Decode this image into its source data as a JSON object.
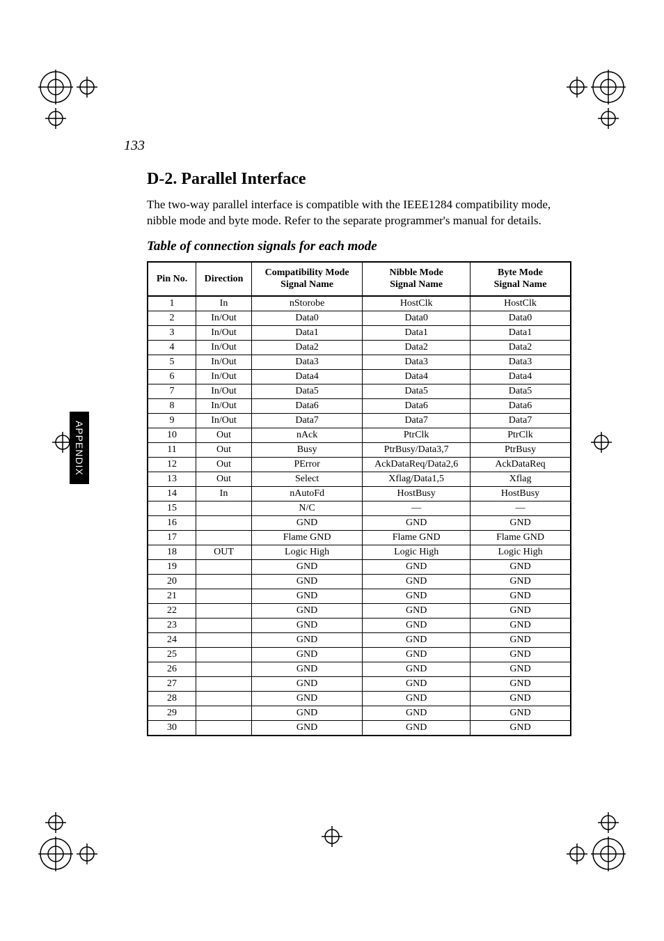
{
  "page_number": "133",
  "heading": "D-2.  Parallel Interface",
  "intro": "The two-way parallel interface is compatible with the IEEE1284 compatibility mode, nibble mode and byte mode. Refer to the separate programmer's manual for details.",
  "table_caption": "Table of connection signals for each mode",
  "side_tab": "APPENDIX",
  "headers": {
    "pin": "Pin No.",
    "dir": "Direction",
    "compat_l1": "Compatibility Mode",
    "compat_l2": "Signal Name",
    "nibble_l1": "Nibble Mode",
    "nibble_l2": "Signal Name",
    "byte_l1": "Byte Mode",
    "byte_l2": "Signal Name"
  },
  "rows": [
    {
      "pin": "1",
      "dir": "In",
      "compat": "nStorobe",
      "nibble": "HostClk",
      "byte": "HostClk"
    },
    {
      "pin": "2",
      "dir": "In/Out",
      "compat": "Data0",
      "nibble": "Data0",
      "byte": "Data0"
    },
    {
      "pin": "3",
      "dir": "In/Out",
      "compat": "Data1",
      "nibble": "Data1",
      "byte": "Data1"
    },
    {
      "pin": "4",
      "dir": "In/Out",
      "compat": "Data2",
      "nibble": "Data2",
      "byte": "Data2"
    },
    {
      "pin": "5",
      "dir": "In/Out",
      "compat": "Data3",
      "nibble": "Data3",
      "byte": "Data3"
    },
    {
      "pin": "6",
      "dir": "In/Out",
      "compat": "Data4",
      "nibble": "Data4",
      "byte": "Data4"
    },
    {
      "pin": "7",
      "dir": "In/Out",
      "compat": "Data5",
      "nibble": "Data5",
      "byte": "Data5"
    },
    {
      "pin": "8",
      "dir": "In/Out",
      "compat": "Data6",
      "nibble": "Data6",
      "byte": "Data6"
    },
    {
      "pin": "9",
      "dir": "In/Out",
      "compat": "Data7",
      "nibble": "Data7",
      "byte": "Data7"
    },
    {
      "pin": "10",
      "dir": "Out",
      "compat": "nAck",
      "nibble": "PtrClk",
      "byte": "PtrClk"
    },
    {
      "pin": "11",
      "dir": "Out",
      "compat": "Busy",
      "nibble": "PtrBusy/Data3,7",
      "byte": "PtrBusy"
    },
    {
      "pin": "12",
      "dir": "Out",
      "compat": "PError",
      "nibble": "AckDataReq/Data2,6",
      "byte": "AckDataReq"
    },
    {
      "pin": "13",
      "dir": "Out",
      "compat": "Select",
      "nibble": "Xflag/Data1,5",
      "byte": "Xflag"
    },
    {
      "pin": "14",
      "dir": "In",
      "compat": "nAutoFd",
      "nibble": "HostBusy",
      "byte": "HostBusy"
    },
    {
      "pin": "15",
      "dir": "",
      "compat": "N/C",
      "nibble": "—",
      "byte": "—"
    },
    {
      "pin": "16",
      "dir": "",
      "compat": "GND",
      "nibble": "GND",
      "byte": "GND"
    },
    {
      "pin": "17",
      "dir": "",
      "compat": "Flame GND",
      "nibble": "Flame GND",
      "byte": "Flame GND"
    },
    {
      "pin": "18",
      "dir": "OUT",
      "compat": "Logic High",
      "nibble": "Logic High",
      "byte": "Logic High"
    },
    {
      "pin": "19",
      "dir": "",
      "compat": "GND",
      "nibble": "GND",
      "byte": "GND"
    },
    {
      "pin": "20",
      "dir": "",
      "compat": "GND",
      "nibble": "GND",
      "byte": "GND"
    },
    {
      "pin": "21",
      "dir": "",
      "compat": "GND",
      "nibble": "GND",
      "byte": "GND"
    },
    {
      "pin": "22",
      "dir": "",
      "compat": "GND",
      "nibble": "GND",
      "byte": "GND"
    },
    {
      "pin": "23",
      "dir": "",
      "compat": "GND",
      "nibble": "GND",
      "byte": "GND"
    },
    {
      "pin": "24",
      "dir": "",
      "compat": "GND",
      "nibble": "GND",
      "byte": "GND"
    },
    {
      "pin": "25",
      "dir": "",
      "compat": "GND",
      "nibble": "GND",
      "byte": "GND"
    },
    {
      "pin": "26",
      "dir": "",
      "compat": "GND",
      "nibble": "GND",
      "byte": "GND"
    },
    {
      "pin": "27",
      "dir": "",
      "compat": "GND",
      "nibble": "GND",
      "byte": "GND"
    },
    {
      "pin": "28",
      "dir": "",
      "compat": "GND",
      "nibble": "GND",
      "byte": "GND"
    },
    {
      "pin": "29",
      "dir": "",
      "compat": "GND",
      "nibble": "GND",
      "byte": "GND"
    },
    {
      "pin": "30",
      "dir": "",
      "compat": "GND",
      "nibble": "GND",
      "byte": "GND"
    }
  ]
}
